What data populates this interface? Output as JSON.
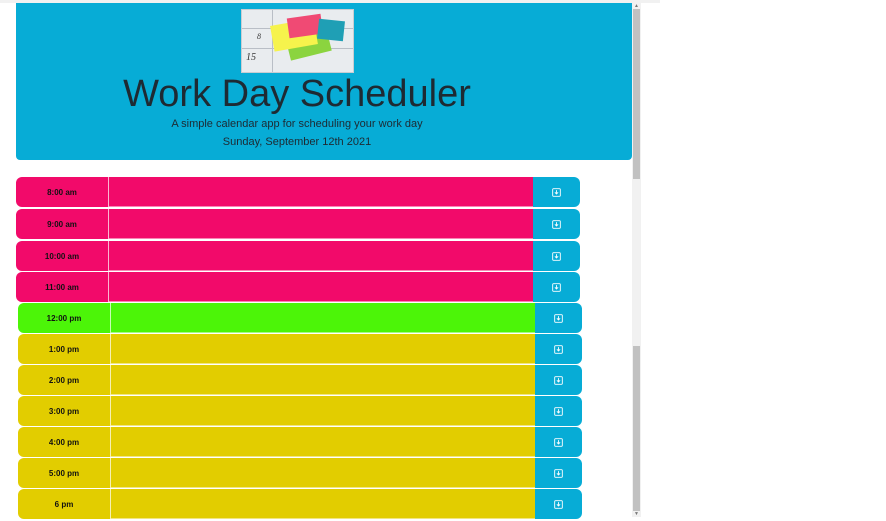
{
  "header": {
    "logo_alt": "Sticky notes on calendar",
    "logo_number": "15",
    "logo_number2": "8",
    "title": "Work Day Scheduler",
    "lead": "A simple calendar app for scheduling your work day",
    "date": "Sunday, September 12th 2021"
  },
  "colors": {
    "header": "#07acd6",
    "past": "#f20a6a",
    "present": "#4cf508",
    "future": "#e2cd00",
    "save": "#07acd6"
  },
  "timeblocks": [
    {
      "hour": "8:00 am",
      "state": "past",
      "text": ""
    },
    {
      "hour": "9:00 am",
      "state": "past",
      "text": ""
    },
    {
      "hour": "10:00 am",
      "state": "past",
      "text": ""
    },
    {
      "hour": "11:00 am",
      "state": "past",
      "text": ""
    },
    {
      "hour": "12:00 pm",
      "state": "present",
      "text": ""
    },
    {
      "hour": "1:00 pm",
      "state": "future",
      "text": ""
    },
    {
      "hour": "2:00 pm",
      "state": "future",
      "text": ""
    },
    {
      "hour": "3:00 pm",
      "state": "future",
      "text": ""
    },
    {
      "hour": "4:00 pm",
      "state": "future",
      "text": ""
    },
    {
      "hour": "5:00 pm",
      "state": "future",
      "text": ""
    },
    {
      "hour": "6 pm",
      "state": "future",
      "text": ""
    }
  ],
  "save_icon": "save-icon"
}
